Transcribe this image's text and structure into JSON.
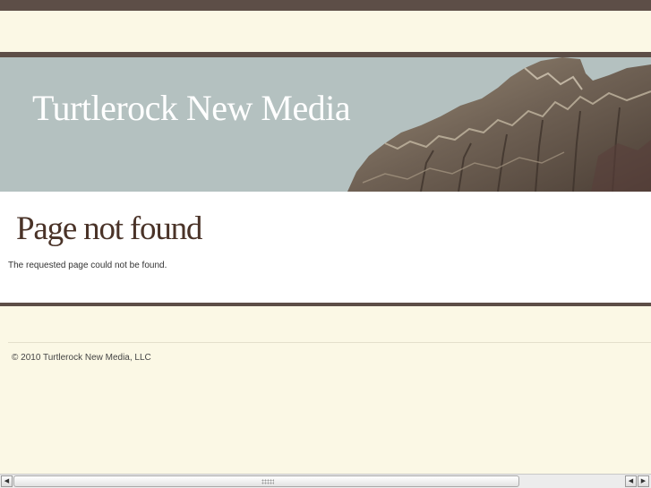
{
  "header": {
    "site_title": "Turtlerock New Media"
  },
  "main": {
    "page_title": "Page not found",
    "message": "The requested page could not be found."
  },
  "footer": {
    "copyright": "© 2010 Turtlerock New Media, LLC"
  },
  "scrollbar": {
    "left_arrow_icon": "triangle-left",
    "right_arrow_icon": "triangle-right"
  },
  "colors": {
    "top_bar": "#5d4e47",
    "banner_sky": "#b4c1c0",
    "page_background": "#fbf8e5",
    "title_text": "#4a3328"
  }
}
